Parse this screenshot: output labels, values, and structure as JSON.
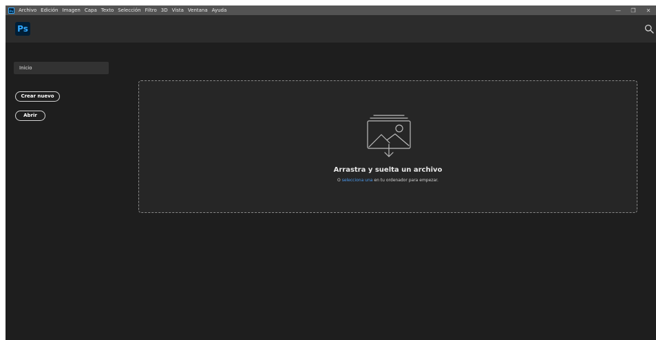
{
  "app": {
    "logo_small": "Ps",
    "logo": "Ps"
  },
  "menubar": {
    "items": [
      "Archivo",
      "Edición",
      "Imagen",
      "Capa",
      "Texto",
      "Selección",
      "Filtro",
      "3D",
      "Vista",
      "Ventana",
      "Ayuda"
    ]
  },
  "window_controls": {
    "minimize": "—",
    "restore": "❐",
    "close": "✕"
  },
  "nav": {
    "home_label": "Inicio",
    "create_new_label": "Crear nuevo",
    "open_label": "Abrir"
  },
  "dropzone": {
    "title": "Arrastra y suelta un archivo",
    "sub_prefix": "O",
    "sub_link": "selecciona una",
    "sub_suffix": "en tu ordenador para empezar."
  },
  "icons": {
    "search": "search-icon",
    "drop": "image-stack-download-icon"
  },
  "colors": {
    "accent": "#31a8ff",
    "link": "#4c9bf0",
    "background": "#1e1e1e",
    "header": "#2c2c2c",
    "menubar": "#535353"
  }
}
